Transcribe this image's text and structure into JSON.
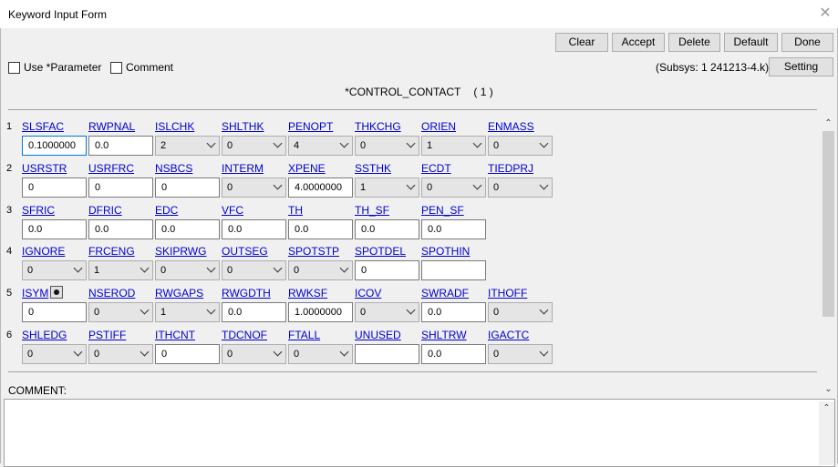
{
  "window": {
    "title": "Keyword Input Form"
  },
  "toolbar": {
    "clear": "Clear",
    "accept": "Accept",
    "delete": "Delete",
    "default": "Default",
    "done": "Done",
    "setting": "Setting"
  },
  "options": {
    "use_parameter": "Use *Parameter",
    "comment": "Comment"
  },
  "subsys": "(Subsys: 1 241213-4.k)",
  "header": {
    "keyword": "*CONTROL_CONTACT",
    "index": "( 1 )"
  },
  "rows": [
    {
      "num": "1",
      "fields": [
        {
          "label": "SLSFAC",
          "value": "0.1000000",
          "type": "input"
        },
        {
          "label": "RWPNAL",
          "value": "0.0",
          "type": "input"
        },
        {
          "label": "ISLCHK",
          "value": "2",
          "type": "select"
        },
        {
          "label": "SHLTHK",
          "value": "0",
          "type": "select"
        },
        {
          "label": "PENOPT",
          "value": "4",
          "type": "select"
        },
        {
          "label": "THKCHG",
          "value": "0",
          "type": "select"
        },
        {
          "label": "ORIEN",
          "value": "1",
          "type": "select"
        },
        {
          "label": "ENMASS",
          "value": "0",
          "type": "select"
        }
      ]
    },
    {
      "num": "2",
      "fields": [
        {
          "label": "USRSTR",
          "value": "0",
          "type": "input"
        },
        {
          "label": "USRFRC",
          "value": "0",
          "type": "input"
        },
        {
          "label": "NSBCS",
          "value": "0",
          "type": "input"
        },
        {
          "label": "INTERM",
          "value": "0",
          "type": "select"
        },
        {
          "label": "XPENE",
          "value": "4.0000000",
          "type": "input"
        },
        {
          "label": "SSTHK",
          "value": "1",
          "type": "select"
        },
        {
          "label": "ECDT",
          "value": "0",
          "type": "select"
        },
        {
          "label": "TIEDPRJ",
          "value": "0",
          "type": "select"
        }
      ]
    },
    {
      "num": "3",
      "fields": [
        {
          "label": "SFRIC",
          "value": "0.0",
          "type": "input"
        },
        {
          "label": "DFRIC",
          "value": "0.0",
          "type": "input"
        },
        {
          "label": "EDC",
          "value": "0.0",
          "type": "input"
        },
        {
          "label": "VFC",
          "value": "0.0",
          "type": "input"
        },
        {
          "label": "TH",
          "value": "0.0",
          "type": "input"
        },
        {
          "label": "TH_SF",
          "value": "0.0",
          "type": "input"
        },
        {
          "label": "PEN_SF",
          "value": "0.0",
          "type": "input"
        }
      ]
    },
    {
      "num": "4",
      "fields": [
        {
          "label": "IGNORE",
          "value": "0",
          "type": "select"
        },
        {
          "label": "FRCENG",
          "value": "1",
          "type": "select"
        },
        {
          "label": "SKIPRWG",
          "value": "0",
          "type": "select"
        },
        {
          "label": "OUTSEG",
          "value": "0",
          "type": "select"
        },
        {
          "label": "SPOTSTP",
          "value": "0",
          "type": "select"
        },
        {
          "label": "SPOTDEL",
          "value": "0",
          "type": "input"
        },
        {
          "label": "SPOTHIN",
          "value": "",
          "type": "input"
        }
      ]
    },
    {
      "num": "5",
      "fields": [
        {
          "label": "ISYM",
          "value": "0",
          "type": "input"
        },
        {
          "label": "NSEROD",
          "value": "0",
          "type": "select"
        },
        {
          "label": "RWGAPS",
          "value": "1",
          "type": "select"
        },
        {
          "label": "RWGDTH",
          "value": "0.0",
          "type": "input"
        },
        {
          "label": "RWKSF",
          "value": "1.0000000",
          "type": "input"
        },
        {
          "label": "ICOV",
          "value": "0",
          "type": "select"
        },
        {
          "label": "SWRADF",
          "value": "0.0",
          "type": "input"
        },
        {
          "label": "ITHOFF",
          "value": "0",
          "type": "select"
        }
      ]
    },
    {
      "num": "6",
      "fields": [
        {
          "label": "SHLEDG",
          "value": "0",
          "type": "select"
        },
        {
          "label": "PSTIFF",
          "value": "0",
          "type": "select"
        },
        {
          "label": "ITHCNT",
          "value": "0",
          "type": "input"
        },
        {
          "label": "TDCNOF",
          "value": "0",
          "type": "select"
        },
        {
          "label": "FTALL",
          "value": "0",
          "type": "select"
        },
        {
          "label": "UNUSED",
          "value": "",
          "type": "input"
        },
        {
          "label": "SHLTRW",
          "value": "0.0",
          "type": "input"
        },
        {
          "label": "IGACTC",
          "value": "0",
          "type": "select"
        }
      ]
    }
  ],
  "comment": {
    "label": "COMMENT:"
  },
  "icons": {
    "close": "close-icon",
    "scroll_up": "chevron-up-icon",
    "scroll_down": "chevron-down-icon"
  }
}
